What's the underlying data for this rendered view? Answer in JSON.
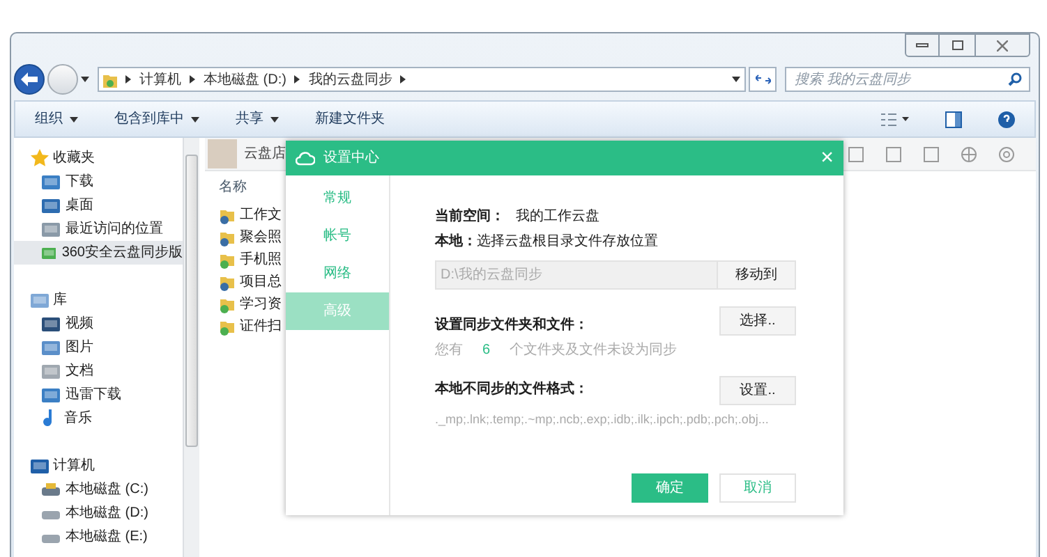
{
  "address_bar": {
    "breadcrumbs": [
      "计算机",
      "本地磁盘 (D:)",
      "我的云盘同步"
    ]
  },
  "search": {
    "placeholder": "搜索 我的云盘同步"
  },
  "toolbar": [
    {
      "label": "组织",
      "dropdown": true
    },
    {
      "label": "包含到库中",
      "dropdown": true
    },
    {
      "label": "共享",
      "dropdown": true
    },
    {
      "label": "新建文件夹",
      "dropdown": false
    }
  ],
  "sidebar": {
    "groups": [
      {
        "label": "收藏夹",
        "kind": "star",
        "children": [
          {
            "label": "下载",
            "kind": "download",
            "selected": false
          },
          {
            "label": "桌面",
            "kind": "desktop",
            "selected": false
          },
          {
            "label": "最近访问的位置",
            "kind": "recent",
            "selected": false
          },
          {
            "label": "360安全云盘同步版",
            "kind": "cloud",
            "selected": true
          }
        ]
      },
      {
        "label": "库",
        "kind": "library",
        "children": [
          {
            "label": "视频",
            "kind": "video",
            "selected": false
          },
          {
            "label": "图片",
            "kind": "picture",
            "selected": false
          },
          {
            "label": "文档",
            "kind": "document",
            "selected": false
          },
          {
            "label": "迅雷下载",
            "kind": "download",
            "selected": false
          },
          {
            "label": "音乐",
            "kind": "music",
            "selected": false
          }
        ]
      },
      {
        "label": "计算机",
        "kind": "computer",
        "children": [
          {
            "label": "本地磁盘 (C:)",
            "kind": "system-drive",
            "selected": false
          },
          {
            "label": "本地磁盘 (D:)",
            "kind": "drive",
            "selected": false
          },
          {
            "label": "本地磁盘 (E:)",
            "kind": "drive",
            "selected": false
          }
        ]
      }
    ]
  },
  "cloud_panel": {
    "user_name": "云盘店",
    "column_header": "名称",
    "files": [
      {
        "name": "工作文",
        "synced": false
      },
      {
        "name": "聚会照",
        "synced": false
      },
      {
        "name": "手机照",
        "synced": true
      },
      {
        "name": "项目总",
        "synced": false
      },
      {
        "name": "学习资",
        "synced": true
      },
      {
        "name": "证件扫",
        "synced": true
      }
    ]
  },
  "dialog": {
    "title": "设置中心",
    "close": "×",
    "tabs": [
      {
        "label": "常规",
        "selected": false
      },
      {
        "label": "帐号",
        "selected": false
      },
      {
        "label": "网络",
        "selected": false
      },
      {
        "label": "高级",
        "selected": true
      }
    ],
    "current_space_label": "当前空间：",
    "current_space_value": "我的工作云盘",
    "local_label": "本地：",
    "local_hint": "选择云盘根目录文件存放位置",
    "path_value": "D:\\我的云盘同步",
    "move_button": "移动到",
    "sync_title": "设置同步文件夹和文件：",
    "sync_prefix": "您有",
    "sync_count": "6",
    "sync_suffix": "个文件夹及文件未设为同步",
    "select_button": "选择..",
    "exclude_title": "本地不同步的文件格式：",
    "settings_button": "设置..",
    "exclude_list": "._mp;.lnk;.temp;.~mp;.ncb;.exp;.idb;.ilk;.ipch;.pdb;.pch;.obj...",
    "ok_button": "确定",
    "cancel_button": "取消"
  }
}
